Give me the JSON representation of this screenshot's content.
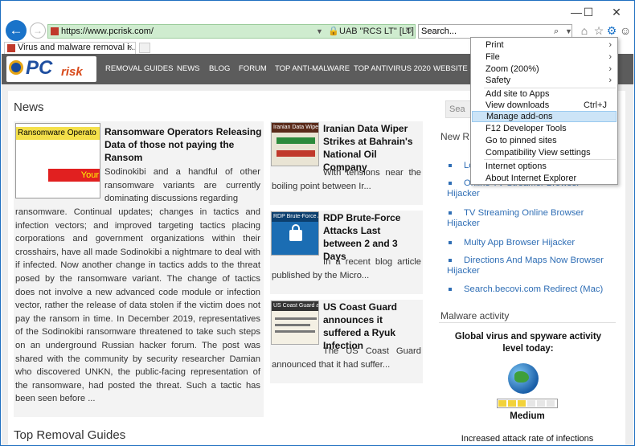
{
  "window": {
    "minimize": "—",
    "maximize": "☐",
    "close": "✕"
  },
  "addressbar": {
    "url": "https://www.pcrisk.com/",
    "cert_label": "UAB \"RCS LT\" [LT]",
    "search_placeholder": "Search..."
  },
  "tab": {
    "title": "Virus and malware removal i..."
  },
  "site": {
    "logo_pc": "PC",
    "logo_risk": "risk",
    "nav": [
      "REMOVAL GUIDES",
      "NEWS",
      "BLOG",
      "FORUM",
      "TOP ANTI-MALWARE",
      "TOP ANTIVIRUS 2020",
      "WEBSITE S"
    ]
  },
  "news": {
    "heading": "News",
    "main": {
      "thumb_text_top": "Ransomware Operato",
      "thumb_text_mid": "Your",
      "title": "Ransomware Operators Releasing Data of those not paying the Ransom",
      "text_lead": "Sodinokibi and a handful of other ransomware variants are currently dominating discussions regarding",
      "text_body": "ransomware. Continual updates; changes in tactics and infection vectors; and improved targeting tactics placing corporations and government organizations within their crosshairs, have all made Sodinokibi a nightmare to deal with if infected. Now another change in tactics adds to the threat posed by the ransomware variant. The change of tactics does not involve a new advanced code module or infection vector, rather the release of data stolen if the victim does not pay the ransom in time. In December 2019, representatives of the Sodinokibi ransomware threatened to take such steps on an underground Russian hacker forum. The post was shared with the community by security researcher Damian who discovered UNKN, the public-facing representation of the ransomware, had posted the threat. Such a tactic has been seen before ..."
    },
    "side": [
      {
        "thumb": "Iranian Data Wiper S",
        "title": "Iranian Data Wiper Strikes at Bahrain's National Oil Company",
        "text": "With tensions near the boiling point between Ir..."
      },
      {
        "thumb": "RDP Brute-Force Att",
        "title": "RDP Brute-Force Attacks Last between 2 and 3 Days",
        "text": "In a recent blog article published by the Micro..."
      },
      {
        "thumb": "US Coast Guard anno",
        "title": "US Coast Guard announces it suffered a Ryuk Infection",
        "text": "The US Coast Guard announced that it had suffer..."
      }
    ]
  },
  "top_removal_heading": "Top Removal Guides",
  "right": {
    "search_label": "Sea",
    "new_heading": "New R",
    "links": [
      "Lo",
      "Online TV Streamer Browser Hijacker",
      "TV Streaming Online Browser Hijacker",
      "Multy App Browser Hijacker",
      "Directions And Maps Now Browser Hijacker",
      "Search.becovi.com Redirect (Mac)"
    ],
    "malware_heading": "Malware activity",
    "global_heading": "Global virus and spyware activity level today:",
    "level": "Medium",
    "level_fraction": 0.5,
    "increased": "Increased attack rate of infections"
  },
  "menu": {
    "items": [
      {
        "label": "Print",
        "arrow": "›"
      },
      {
        "label": "File",
        "arrow": "›"
      },
      {
        "label": "Zoom (200%)",
        "arrow": "›"
      },
      {
        "label": "Safety",
        "arrow": "›"
      },
      {
        "label": "Add site to Apps"
      },
      {
        "label": "View downloads",
        "shortcut": "Ctrl+J"
      },
      {
        "label": "Manage add-ons"
      },
      {
        "label": "F12 Developer Tools"
      },
      {
        "label": "Go to pinned sites"
      },
      {
        "label": "Compatibility View settings"
      },
      {
        "label": "Internet options"
      },
      {
        "label": "About Internet Explorer"
      }
    ]
  },
  "colors": {
    "accent": "#1a73c9",
    "link": "#2f6eb5",
    "header": "#5c5c5c",
    "highlight": "#cce4f7"
  }
}
